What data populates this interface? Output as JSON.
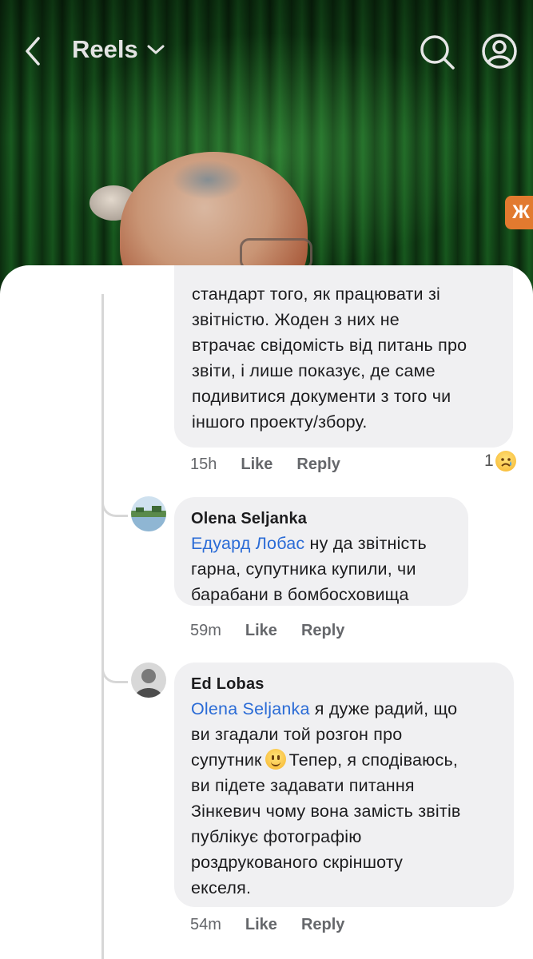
{
  "header": {
    "title": "Reels"
  },
  "video": {
    "side_logo_text": "Ж"
  },
  "comments": [
    {
      "lines": [
        "стандарт того, як працювати зі",
        "звітністю. Жоден з них не",
        "втрачає свідомість від питань про",
        "звіти, і лише показує, де саме",
        "подивитися документи з того чи",
        "іншого проекту/збору."
      ],
      "time": "15h",
      "like_label": "Like",
      "reply_label": "Reply",
      "reaction_count": "1"
    },
    {
      "author": "Olena Seljanka",
      "mention": "Едуард Лобас",
      "line1_rest": " ну да звітність",
      "lines": [
        "гарна, супутника купили, чи",
        "барабани в бомбосховища"
      ],
      "time": "59m",
      "like_label": "Like",
      "reply_label": "Reply"
    },
    {
      "author": "Ed Lobas",
      "mention": "Olena Seljanka",
      "line1_rest": " я дуже радий, що",
      "line2": "ви згадали той розгон про",
      "line3_a": "супутник",
      "line3_b": "Тепер, я сподіваюсь,",
      "lines": [
        "ви підете задавати питання",
        "Зінкевич чому вона замість звітів",
        "публікує фотографію",
        "роздрукованого скріншоту",
        "екселя."
      ],
      "time": "54m",
      "like_label": "Like",
      "reply_label": "Reply"
    }
  ],
  "colors": {
    "mention": "#2a6bd6",
    "bubble": "#f0f0f2",
    "meta_text": "#65676b"
  }
}
